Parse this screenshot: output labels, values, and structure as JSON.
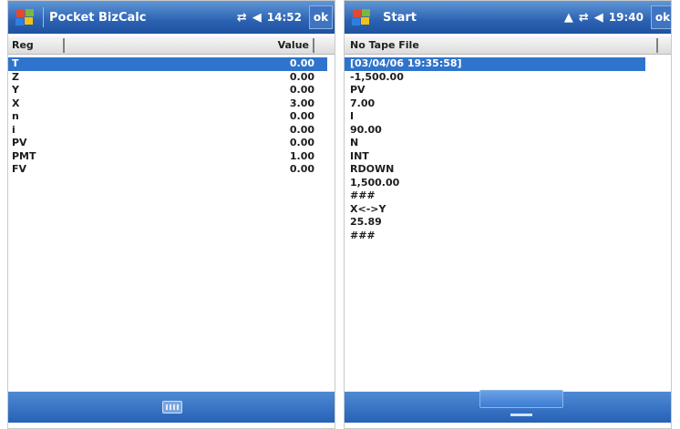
{
  "left_screen": {
    "title": "Pocket BizCalc",
    "clock": "14:52",
    "ok_label": "ok",
    "columns": {
      "reg": "Reg",
      "value": "Value"
    },
    "rows": [
      {
        "reg": "T",
        "value": "0.00"
      },
      {
        "reg": "Z",
        "value": "0.00"
      },
      {
        "reg": "Y",
        "value": "0.00"
      },
      {
        "reg": "X",
        "value": "3.00"
      },
      {
        "reg": "n",
        "value": "0.00"
      },
      {
        "reg": "i",
        "value": "0.00"
      },
      {
        "reg": "PV",
        "value": "0.00"
      },
      {
        "reg": "PMT",
        "value": "1.00"
      },
      {
        "reg": "FV",
        "value": "0.00"
      }
    ],
    "selected_row": 0,
    "icons": [
      "windows-logo",
      "connectivity-icon",
      "speaker-icon",
      "keyboard-icon"
    ]
  },
  "right_screen": {
    "title": "Start",
    "clock": "19:40",
    "ok_label": "ok",
    "column_header": "No Tape File",
    "tape_lines": [
      "[03/04/06 19:35:58]",
      "-1,500.00",
      "PV",
      "7.00",
      "I",
      "90.00",
      "N",
      "INT",
      "RDOWN",
      "1,500.00",
      "###",
      "X<->Y",
      "25.89",
      "###"
    ],
    "selected_line": 0,
    "icons": [
      "windows-logo",
      "notification-icon",
      "sync-icon",
      "speaker-icon",
      "input-panel-icon"
    ]
  },
  "colors": {
    "titlebar": "#2c62b2",
    "selection": "#2f74cc",
    "bottombar": "#3a74c4"
  }
}
